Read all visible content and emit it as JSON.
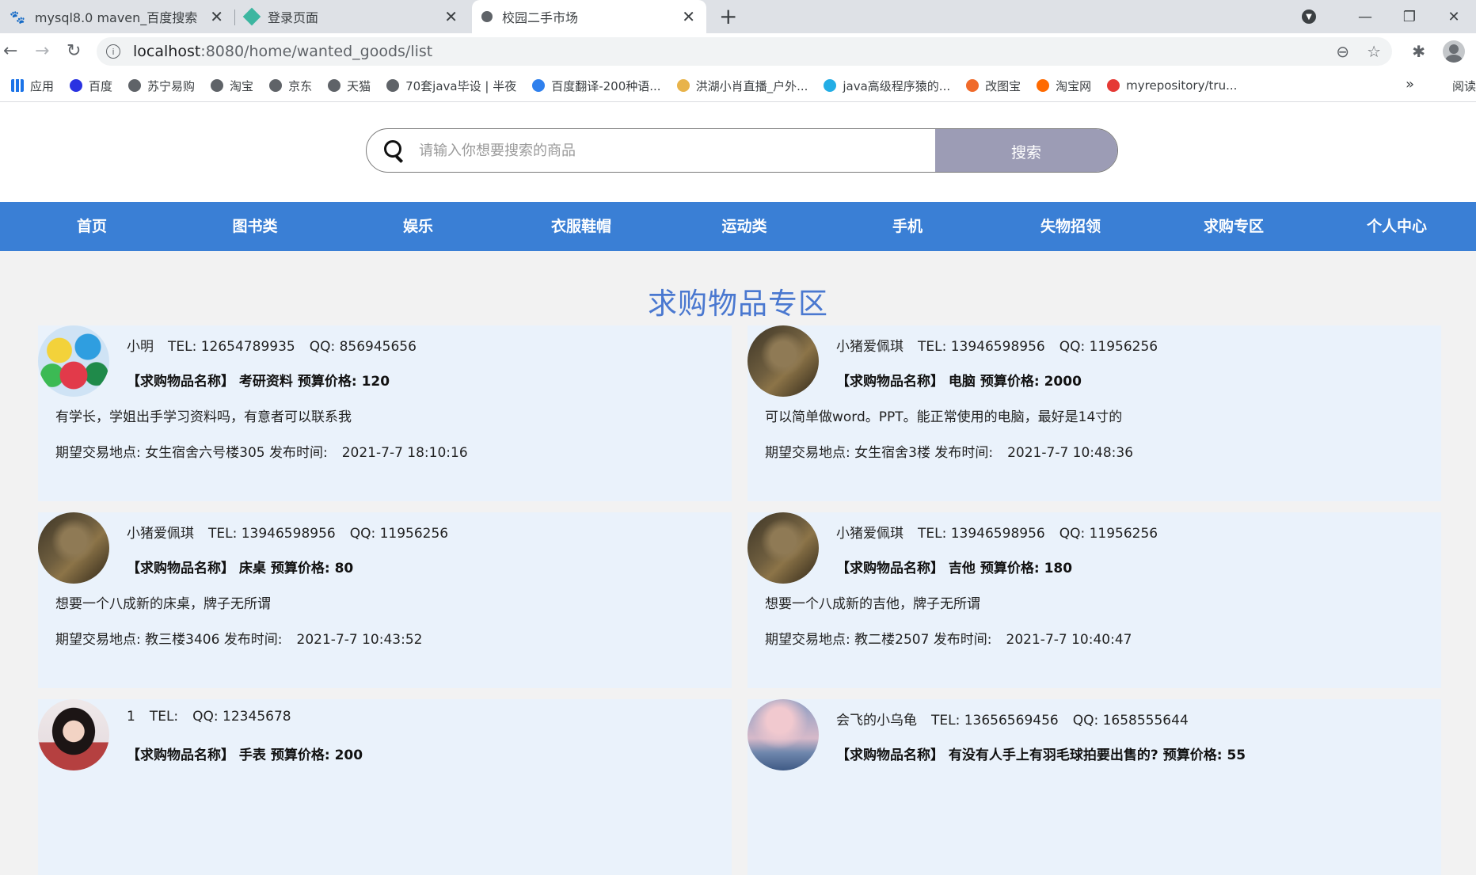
{
  "browser": {
    "tabs": [
      {
        "title": "mysql8.0 maven_百度搜索"
      },
      {
        "title": "登录页面"
      },
      {
        "title": "校园二手市场"
      }
    ],
    "url_host": "localhost",
    "url_path": ":8080/home/wanted_goods/list"
  },
  "bookmarks": [
    {
      "label": "应用",
      "color": "#1a73e8"
    },
    {
      "label": "百度",
      "color": "#2932e1"
    },
    {
      "label": "苏宁易购",
      "color": "#5f6368"
    },
    {
      "label": "淘宝",
      "color": "#5f6368"
    },
    {
      "label": "京东",
      "color": "#5f6368"
    },
    {
      "label": "天猫",
      "color": "#5f6368"
    },
    {
      "label": "70套java毕设 | 半夜",
      "color": "#5f6368"
    },
    {
      "label": "百度翻译-200种语...",
      "color": "#2f80ed"
    },
    {
      "label": "洪湖小肖直播_户外...",
      "color": "#e8b34a"
    },
    {
      "label": "java高级程序猿的...",
      "color": "#23ade5"
    },
    {
      "label": "改图宝",
      "color": "#f06a2a"
    },
    {
      "label": "淘宝网",
      "color": "#ff6a00"
    },
    {
      "label": "myrepository/tru...",
      "color": "#e53935"
    }
  ],
  "bookmarks_more": "»",
  "bookmarks_reading": "阅读",
  "search": {
    "placeholder": "请输入你想要搜索的商品",
    "button": "搜索"
  },
  "nav": [
    "首页",
    "图书类",
    "娱乐",
    "衣服鞋帽",
    "运动类",
    "手机",
    "失物招领",
    "求购专区",
    "个人中心"
  ],
  "section_title": "求购物品专区",
  "labels": {
    "name_prefix": "【求购物品名称】",
    "budget": "预算价格:",
    "place": "期望交易地点:",
    "time": "发布时间:"
  },
  "posts": [
    {
      "user": "小明",
      "tel": "TEL: 12654789935",
      "qq": "QQ: 856945656",
      "item": "考研资料",
      "price": "120",
      "desc": "有学长，学姐出手学习资料吗，有意者可以联系我",
      "place": "女生宿舍六号楼305",
      "time": "2021-7-7 18:10:16",
      "avatar": "umbrella"
    },
    {
      "user": "小猪爱佩琪",
      "tel": "TEL: 13946598956",
      "qq": "QQ: 11956256",
      "item": "电脑",
      "price": "2000",
      "desc": "可以简单做word。PPT。能正常使用的电脑，最好是14寸的",
      "place": "女生宿舍3楼",
      "time": "2021-7-7 10:48:36",
      "avatar": "bear"
    },
    {
      "user": "小猪爱佩琪",
      "tel": "TEL: 13946598956",
      "qq": "QQ: 11956256",
      "item": "床桌",
      "price": "80",
      "desc": "想要一个八成新的床桌，牌子无所谓",
      "place": "教三楼3406",
      "time": "2021-7-7 10:43:52",
      "avatar": "bear"
    },
    {
      "user": "小猪爱佩琪",
      "tel": "TEL: 13946598956",
      "qq": "QQ: 11956256",
      "item": "吉他",
      "price": "180",
      "desc": "想要一个八成新的吉他，牌子无所谓",
      "place": "教二楼2507",
      "time": "2021-7-7 10:40:47",
      "avatar": "bear"
    },
    {
      "user": "1",
      "tel": "TEL:",
      "qq": "QQ: 12345678",
      "item": "手表",
      "price": "200",
      "desc": "",
      "place": "",
      "time": "",
      "avatar": "girl"
    },
    {
      "user": "会飞的小乌龟",
      "tel": "TEL: 13656569456",
      "qq": "QQ: 1658555644",
      "item": "有没有人手上有羽毛球拍要出售的?",
      "price": "55",
      "desc": "",
      "place": "",
      "time": "",
      "avatar": "sky"
    }
  ]
}
